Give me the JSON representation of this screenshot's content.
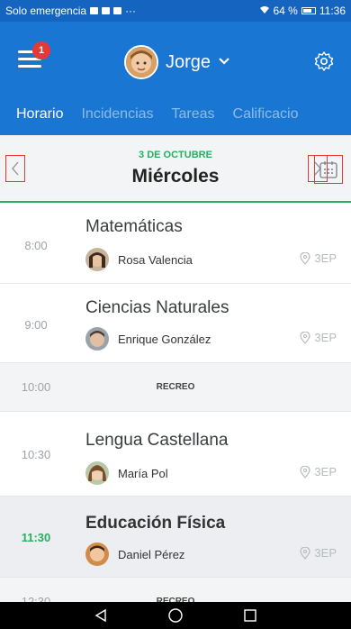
{
  "status_bar": {
    "carrier": "Solo emergencia",
    "extra": "···",
    "battery": "64 %",
    "time": "11:36"
  },
  "header": {
    "badge_count": "1",
    "user_name": "Jorge"
  },
  "tabs": [
    {
      "label": "Horario",
      "active": true
    },
    {
      "label": "Incidencias",
      "active": false
    },
    {
      "label": "Tareas",
      "active": false
    },
    {
      "label": "Calificacio",
      "active": false
    }
  ],
  "day_nav": {
    "date": "3 DE OCTUBRE",
    "weekday": "Miércoles"
  },
  "schedule": [
    {
      "time": "8:00",
      "subject": "Matemáticas",
      "teacher": "Rosa Valencia",
      "room": "3EP"
    },
    {
      "time": "9:00",
      "subject": "Ciencias Naturales",
      "teacher": "Enrique González",
      "room": "3EP"
    },
    {
      "time": "10:00",
      "label": "RECREO"
    },
    {
      "time": "10:30",
      "subject": "Lengua Castellana",
      "teacher": "María Pol",
      "room": "3EP"
    },
    {
      "time": "11:30",
      "subject": "Educación Física",
      "teacher": "Daniel Pérez",
      "room": "3EP"
    },
    {
      "time": "12:30",
      "label": "RECREO"
    }
  ],
  "colors": {
    "primary": "#1976d2",
    "accent_green": "#27ae60",
    "badge_red": "#e53935"
  }
}
